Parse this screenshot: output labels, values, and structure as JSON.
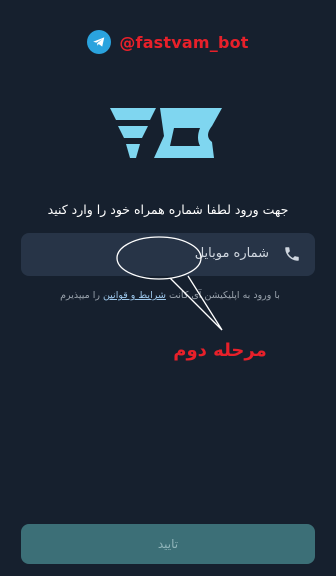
{
  "header": {
    "handle": "@fastvam_bot"
  },
  "login": {
    "prompt": "جهت ورود لطفا شماره همراه خود را وارد کنید",
    "phone_placeholder": "شماره موبایل",
    "terms_prefix": "با ورود به اپلیکیشن آی کانت",
    "terms_link": "شرایط و قوانین",
    "terms_suffix": "را میپذیرم",
    "submit_label": "تایید"
  },
  "annotation": {
    "label": "مرحله دوم"
  },
  "colors": {
    "background": "#16202e",
    "input": "#273447",
    "button": "#3c6f77",
    "annotation": "#e8202a",
    "logo": "#7fd6f0"
  },
  "icons": {
    "telegram": "telegram-icon",
    "phone": "phone-icon",
    "logo": "app-logo"
  }
}
